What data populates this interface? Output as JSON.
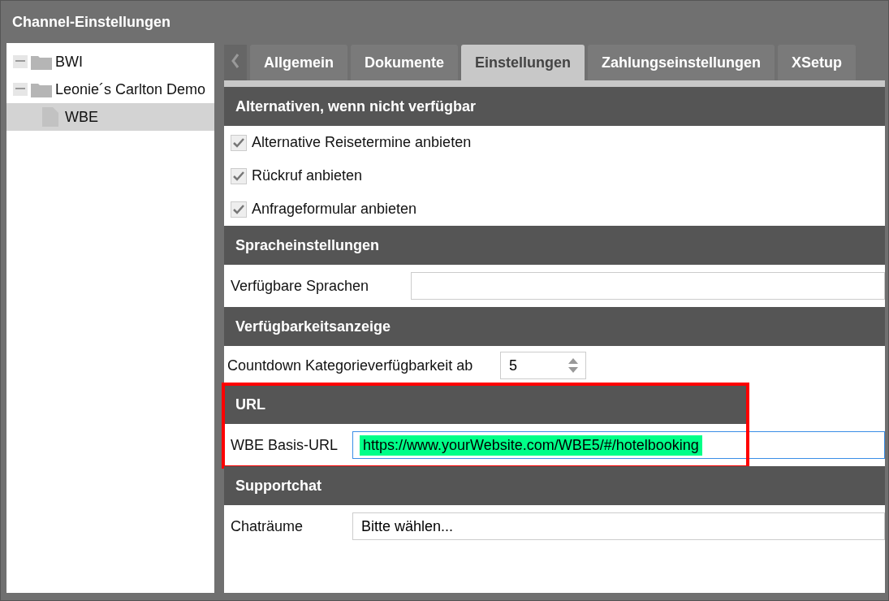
{
  "window": {
    "title": "Channel-Einstellungen"
  },
  "tree": [
    {
      "label": "BWI",
      "expanded": true,
      "selected": false
    },
    {
      "label": "Leonie´s Carlton Demo",
      "expanded": true,
      "selected": false,
      "children": [
        {
          "label": "WBE",
          "selected": true
        }
      ]
    }
  ],
  "tabs": [
    {
      "label": "Allgemein",
      "selected": false
    },
    {
      "label": "Dokumente",
      "selected": false
    },
    {
      "label": "Einstellungen",
      "selected": true
    },
    {
      "label": "Zahlungseinstellungen",
      "selected": false
    },
    {
      "label": "XSetup",
      "selected": false
    }
  ],
  "sections": [
    {
      "title": "Alternativen, wenn nicht verfügbar",
      "highlighted": false,
      "rows": [
        {
          "kind": "checkbox",
          "label": "Alternative Reisetermine anbieten",
          "checked": true
        },
        {
          "kind": "checkbox",
          "label": "Rückruf anbieten",
          "checked": true
        },
        {
          "kind": "checkbox",
          "label": "Anfrageformular anbieten",
          "checked": true
        }
      ]
    },
    {
      "title": "Spracheinstellungen",
      "highlighted": false,
      "rows": [
        {
          "kind": "text",
          "label": "Verfügbare Sprachen"
        }
      ]
    },
    {
      "title": "Verfügbarkeitsanzeige",
      "highlighted": false,
      "rows": [
        {
          "kind": "spinner",
          "label": "Countdown Kategorieverfügbarkeit ab",
          "value": "5"
        }
      ]
    },
    {
      "title": "URL",
      "highlighted": true,
      "rows": [
        {
          "kind": "url",
          "label": "WBE Basis-URL",
          "value": "https://www.yourWebsite.com/WBE5/#/hotelbooking"
        }
      ]
    },
    {
      "title": "Supportchat",
      "highlighted": false,
      "rows": [
        {
          "kind": "select",
          "label": "Chaträume",
          "value": "Bitte wählen..."
        }
      ]
    }
  ]
}
